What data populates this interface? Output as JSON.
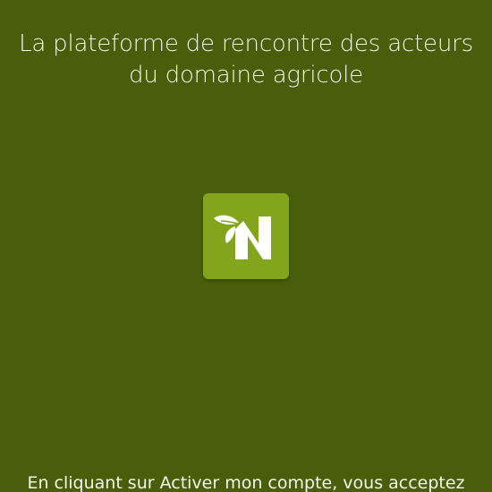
{
  "header": {
    "tagline_line1": "La plateforme de rencontre des acteurs",
    "tagline_line2": "du domaine agricole"
  },
  "logo": {
    "letter": "N",
    "icon": "leaf-n-logo-icon"
  },
  "footer": {
    "terms_text": "En cliquant sur Activer mon compte, vous acceptez"
  },
  "colors": {
    "background": "#495e0b",
    "logo_tile": "#82a51c",
    "text": "#ffffff"
  }
}
